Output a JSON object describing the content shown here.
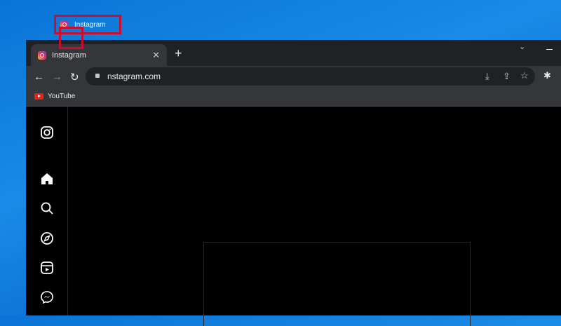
{
  "desktop": {
    "shortcut_label": "Instagram"
  },
  "browser": {
    "tab": {
      "title": "Instagram",
      "close": "✕"
    },
    "new_tab": "+",
    "url": "nstagram.com",
    "bookmarks": [
      {
        "label": "YouTube"
      }
    ],
    "toolbar_icons": [
      "back-icon",
      "forward-icon",
      "reload-icon",
      "lock-icon",
      "install-icon",
      "share-icon",
      "star-icon",
      "extensions-icon"
    ]
  },
  "instagram": {
    "sidebar_icons": [
      "instagram-logo-icon",
      "home-icon",
      "search-icon",
      "explore-icon",
      "reels-icon",
      "messenger-icon"
    ]
  },
  "colors": {
    "highlight": "#c8102e",
    "desktop": "#0a74d6"
  }
}
